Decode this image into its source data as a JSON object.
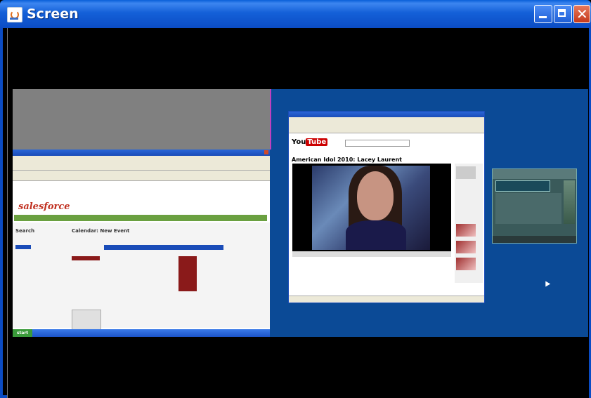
{
  "window": {
    "title": "Screen",
    "minimize_label": "",
    "maximize_label": "",
    "close_label": ""
  },
  "colors": {
    "titlebar": "#0b4cc4",
    "desktop": "#0b4a96",
    "gray_area": "#808080",
    "close_button": "#c4381a"
  },
  "screens": {
    "left": {
      "logo_text": "salesforce",
      "heading": "Calendar: New Event",
      "search_label": "Search",
      "start_label": "start"
    },
    "youtube": {
      "logo_you": "You",
      "logo_tube": "Tube",
      "video_title": "American Idol 2010: Lacey Laurent"
    },
    "small": {}
  }
}
